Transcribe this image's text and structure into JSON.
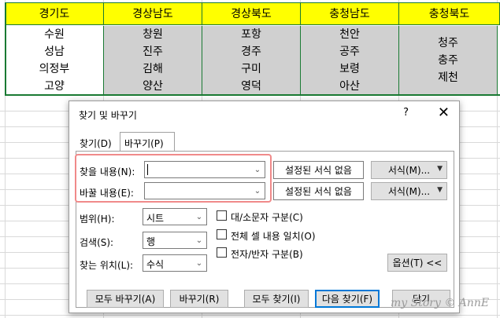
{
  "sheet": {
    "headers": [
      "경기도",
      "경상남도",
      "경상북도",
      "충청남도",
      "충청북도"
    ],
    "columns": [
      [
        "수원",
        "성남",
        "의정부",
        "고양"
      ],
      [
        "창원",
        "진주",
        "김해",
        "양산"
      ],
      [
        "포항",
        "경주",
        "구미",
        "영덕"
      ],
      [
        "천안",
        "공주",
        "보령",
        "아산"
      ],
      [
        "청주",
        "충주",
        "제천"
      ]
    ],
    "header_color": "#ffff00",
    "selection_color": "#d0d0d0",
    "border_color": "#1a7a33"
  },
  "dialog": {
    "title": "찾기 및 바꾸기",
    "help": "?",
    "close": "✕",
    "tabs": [
      "찾기(D)",
      "바꾸기(P)"
    ],
    "find_label": "찾을 내용(N):",
    "replace_label": "바꿀 내용(E):",
    "find_value": "",
    "replace_value": "",
    "no_format_1": "설정된 서식 없음",
    "no_format_2": "설정된 서식 없음",
    "format_1": "서식(M)...",
    "format_2": "서식(M)...",
    "within_label": "범위(H):",
    "within_value": "시트",
    "search_label": "검색(S):",
    "search_value": "행",
    "lookin_label": "찾는 위치(L):",
    "lookin_value": "수식",
    "match_case": "대/소문자 구분(C)",
    "match_entire": "전체 셀 내용 일치(O)",
    "match_byte": "전자/반자 구분(B)",
    "options": "옵션(T) <<",
    "replace_all": "모두 바꾸기(A)",
    "replace": "바꾸기(R)",
    "find_all": "모두 찾기(I)",
    "find_next": "다음 찾기(F)",
    "close_button": "닫기"
  },
  "watermark": "my Story © AnnE"
}
